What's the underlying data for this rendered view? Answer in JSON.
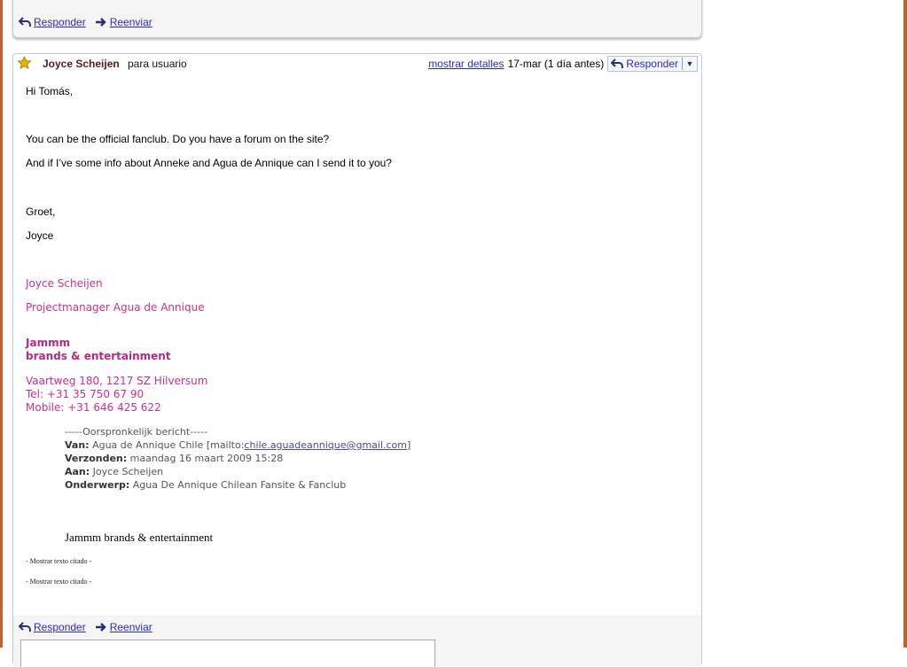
{
  "prev_message": {
    "reply_label": "Responder",
    "forward_label": "Reenviar"
  },
  "message": {
    "sender": "Joyce Scheijen",
    "recipient": "para usuario",
    "show_details": "mostrar detalles",
    "date": "17-mar (1 día antes)",
    "reply_button": "Responder",
    "dropdown_glyph": "▼",
    "body": [
      "Hi Tomás,",
      "You can be the official fanclub. Do you have a forum on the site?",
      "And if I’ve some info about Anneke and Agua de Annique can I send it to you?",
      "Groet,",
      "Joyce"
    ],
    "signature": {
      "name": "Joyce Scheijen",
      "role": "Projectmanager Agua de Annique",
      "company_line1": "Jammm",
      "company_line2": "brands & entertainment",
      "address": "Vaartweg 180, 1217 SZ Hilversum",
      "tel": "Tel: +31 35 750 67 90",
      "mobile": "Mobile: +31 646 425 622"
    },
    "original": {
      "header": "-----Oorspronkelijk bericht-----",
      "from_label": "Van:",
      "from_value": "Agua de Annique Chile [mailto:",
      "from_email": "chile.aguadeannique@gmail.com",
      "from_close": "]",
      "sent_label": "Verzonden:",
      "sent_value": "maandag 16 maart 2009 15:28",
      "to_label": "Aan:",
      "to_value": "Joyce Scheijen",
      "subject_label": "Onderwerp:",
      "subject_value": "Agua De Annique Chilean Fansite & Fanclub"
    },
    "company_serif": "Jammm brands & entertainment",
    "quoted_1": "- Mostrar texto citado -",
    "quoted_2": "- Mostrar texto citado -",
    "footer_reply": "Responder",
    "footer_forward": "Reenviar"
  },
  "colors": {
    "frame": "#c4602e",
    "link": "#2a2acc",
    "signature": "#cc2f8a",
    "sender": "#5a1a1a",
    "star": "#e8b400"
  },
  "icons": [
    "reply-icon",
    "forward-icon",
    "star-icon",
    "dropdown-arrow-icon"
  ]
}
